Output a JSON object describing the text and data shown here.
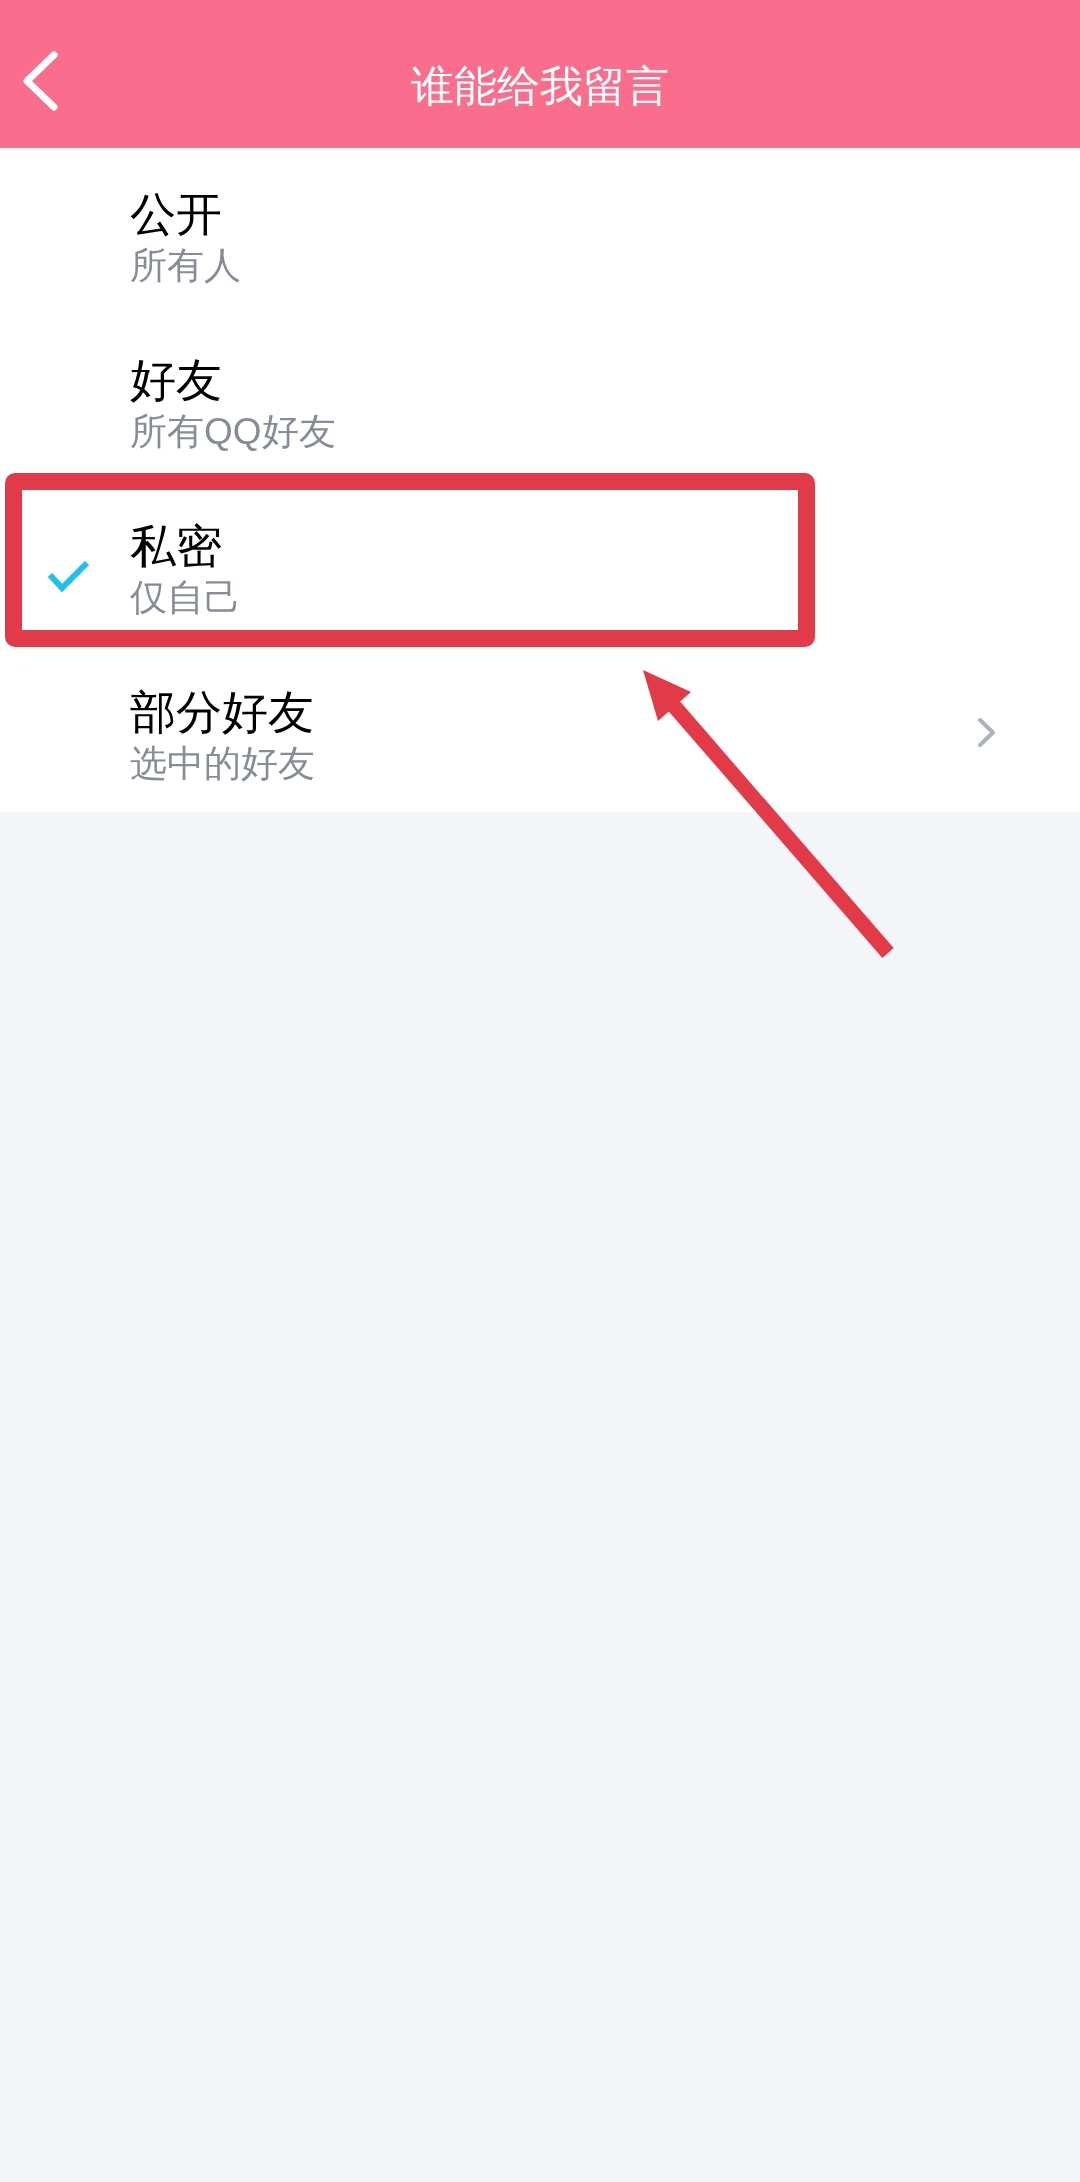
{
  "header": {
    "title": "谁能给我留言"
  },
  "options": [
    {
      "kind": "choice",
      "title": "公开",
      "subtitle": "所有人",
      "selected": false
    },
    {
      "kind": "choice",
      "title": "好友",
      "subtitle": "所有QQ好友",
      "selected": false
    },
    {
      "kind": "choice",
      "title": "私密",
      "subtitle": "仅自己",
      "selected": true
    },
    {
      "kind": "submenu",
      "title": "部分好友",
      "subtitle": "选中的好友",
      "selected": false
    }
  ]
}
